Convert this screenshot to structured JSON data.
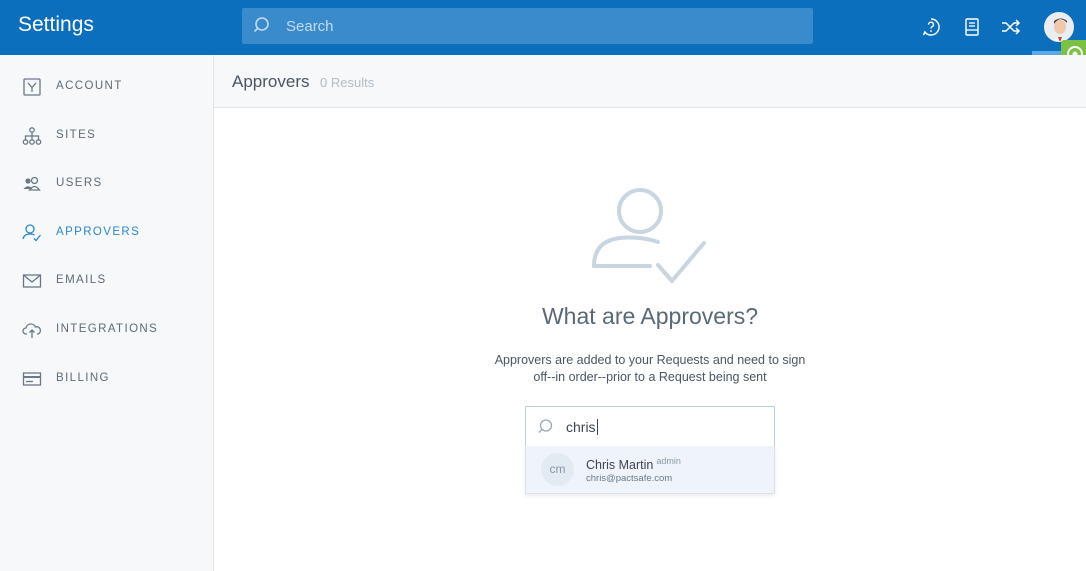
{
  "app": {
    "title": "Settings"
  },
  "search": {
    "placeholder": "Search"
  },
  "topbar": {
    "icons": [
      "help-icon",
      "document-icon",
      "shuffle-icon"
    ]
  },
  "sidebar": {
    "items": [
      {
        "label": "ACCOUNT",
        "icon": "account-icon",
        "active": false
      },
      {
        "label": "SITES",
        "icon": "sites-icon",
        "active": false
      },
      {
        "label": "USERS",
        "icon": "users-icon",
        "active": false
      },
      {
        "label": "APPROVERS",
        "icon": "approvers-icon",
        "active": true
      },
      {
        "label": "EMAILS",
        "icon": "mail-icon",
        "active": false
      },
      {
        "label": "INTEGRATIONS",
        "icon": "cloud-icon",
        "active": false
      },
      {
        "label": "BILLING",
        "icon": "credit-card-icon",
        "active": false
      }
    ]
  },
  "page": {
    "title": "Approvers",
    "result_count": "0 Results"
  },
  "empty_state": {
    "title": "What are Approvers?",
    "description": "Approvers are added to your Requests and need to sign off--in order--prior to a Request being sent"
  },
  "approver_search": {
    "value": "chris"
  },
  "suggestions": [
    {
      "initials": "cm",
      "name": "Chris Martin",
      "role": "admin",
      "email": "chris@pactsafe.com"
    }
  ],
  "colors": {
    "brand": "#0c6fbd",
    "accent": "#2b86cf",
    "tab": "#7bc143"
  }
}
